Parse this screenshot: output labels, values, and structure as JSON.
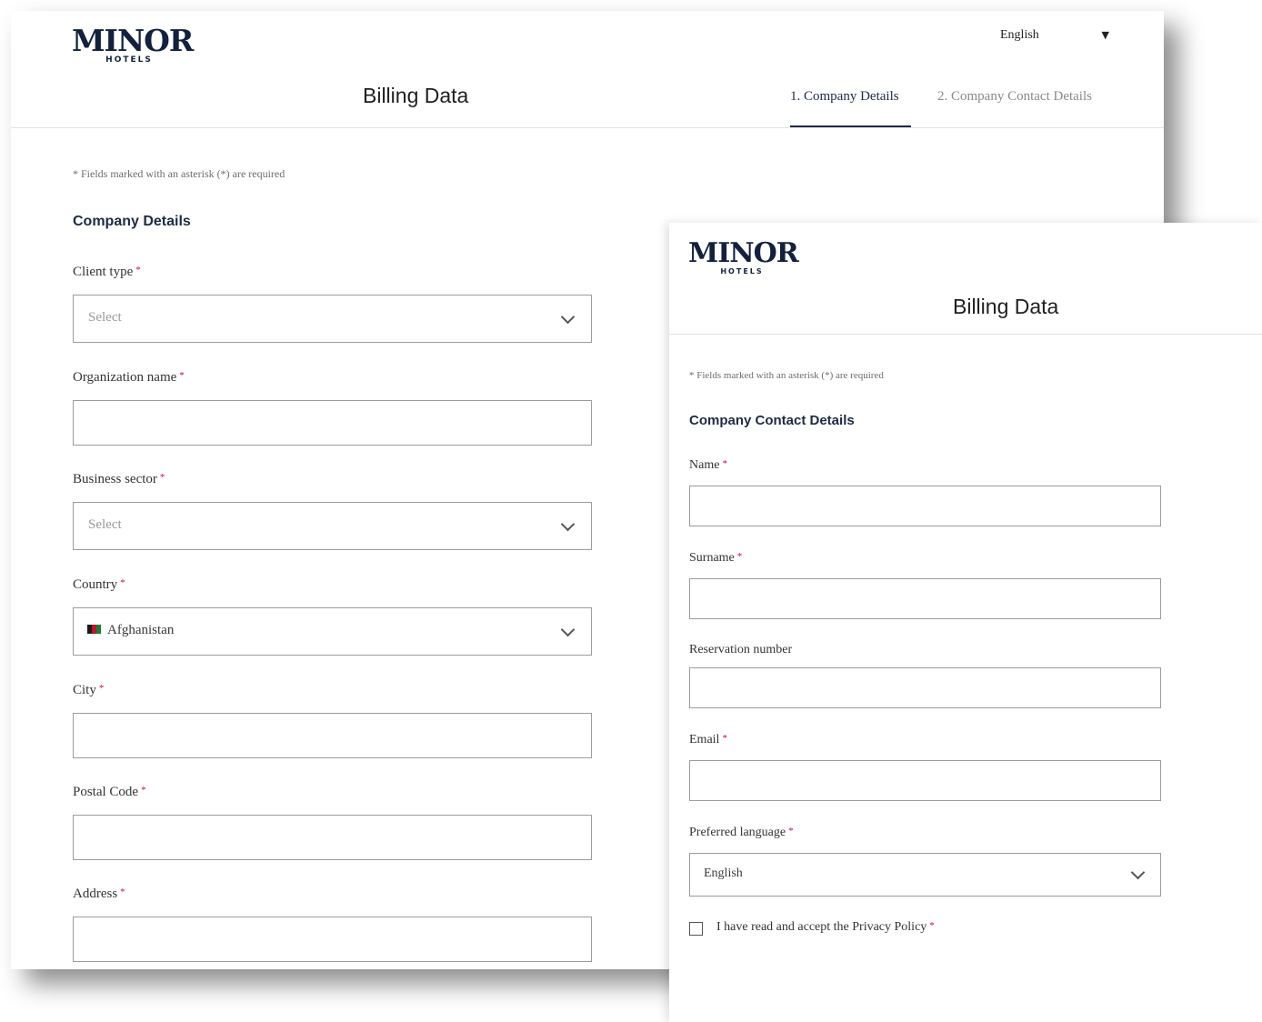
{
  "brand": {
    "logo_text": "MINOR",
    "logo_subtext": "HOTELS"
  },
  "step1": {
    "page_title": "Billing Data",
    "language_selector": {
      "selected": "English"
    },
    "steps": [
      {
        "label": "1. Company Details",
        "active": true
      },
      {
        "label": "2. Company Contact Details",
        "active": false
      }
    ],
    "required_note": "* Fields marked with an asterisk (*) are required",
    "section_title": "Company Details",
    "fields": {
      "client_type": {
        "label": "Client type",
        "placeholder": "Select"
      },
      "organization_name": {
        "label": "Organization name"
      },
      "business_sector": {
        "label": "Business sector",
        "placeholder": "Select"
      },
      "country": {
        "label": "Country",
        "value": "Afghanistan"
      },
      "city": {
        "label": "City"
      },
      "postal_code": {
        "label": "Postal Code"
      },
      "address": {
        "label": "Address"
      }
    },
    "required_marker": "*"
  },
  "step2": {
    "page_title": "Billing Data",
    "required_note": "* Fields marked with an asterisk (*) are required",
    "section_title": "Company Contact Details",
    "fields": {
      "name": {
        "label": "Name"
      },
      "surname": {
        "label": "Surname"
      },
      "reservation_number": {
        "label": "Reservation number"
      },
      "email": {
        "label": "Email"
      },
      "preferred_language": {
        "label": "Preferred language",
        "value": "English"
      }
    },
    "privacy_checkbox": {
      "label": "I have read and accept the Privacy Policy",
      "checked": false
    },
    "required_marker": "*"
  },
  "colors": {
    "brand_navy": "#14213d",
    "required_red": "#c8102e",
    "border_gray": "#9c9c9c"
  }
}
